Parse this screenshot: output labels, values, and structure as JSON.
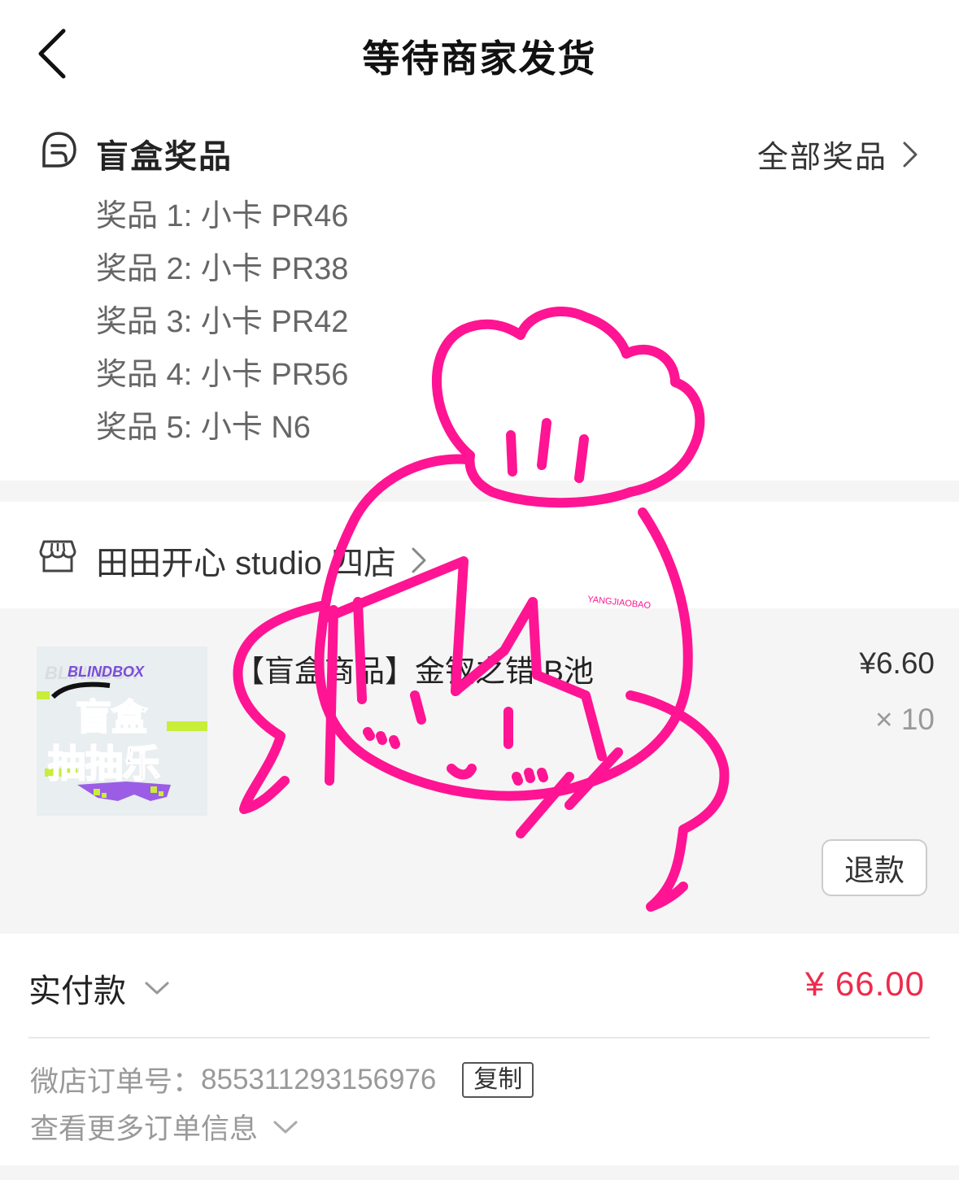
{
  "header": {
    "title": "等待商家发货"
  },
  "prizes": {
    "heading": "盲盒奖品",
    "all_link": "全部奖品",
    "items": [
      "奖品 1: 小卡 PR46",
      "奖品 2: 小卡 PR38",
      "奖品 3: 小卡 PR42",
      "奖品 4: 小卡 PR56",
      "奖品 5: 小卡 N6"
    ]
  },
  "store": {
    "name": "田田开心 studio 四店"
  },
  "product": {
    "name": "【盲盒商品】金钗之错 B池",
    "price": "¥6.60",
    "quantity": "× 10",
    "refund_label": "退款",
    "thumb_brand": "BLINDBOX",
    "thumb_line1": "盲盒",
    "thumb_line2": "抽抽乐"
  },
  "payment": {
    "label": "实付款",
    "amount": "¥ 66.00",
    "order_label": "微店订单号：",
    "order_number": "855311293156976",
    "copy_label": "复制",
    "more_info": "查看更多订单信息"
  },
  "overlay": {
    "watermark": "YANGJIAOBAO"
  },
  "colors": {
    "accent_red": "#ee2b4d",
    "doodle_pink": "#ff1493"
  },
  "icons": [
    "chevron-left-icon",
    "gift-list-icon",
    "chevron-right-icon",
    "store-icon",
    "chevron-down-icon"
  ]
}
